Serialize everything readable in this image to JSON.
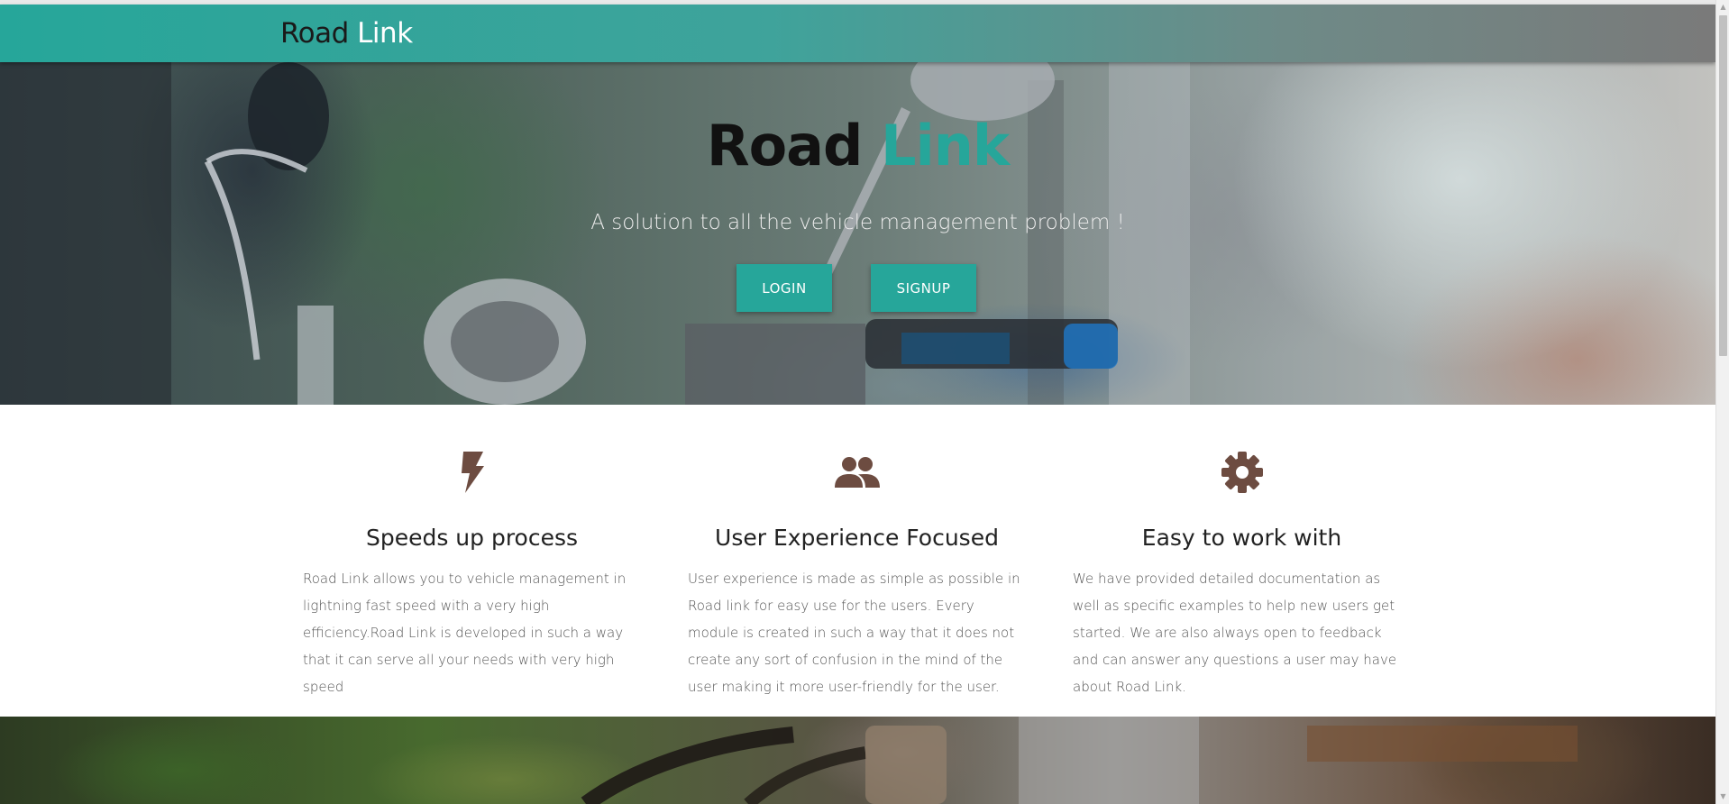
{
  "navbar": {
    "brand_part1": "Road",
    "brand_part2": "Link"
  },
  "hero": {
    "title_part1": "Road",
    "title_part2": "Link",
    "subtitle": "A solution to all the vehicle management problem !",
    "login_label": "LOGIN",
    "signup_label": "SIGNUP"
  },
  "features": [
    {
      "icon": "flash-icon",
      "title": "Speeds up process",
      "text": "Road Link allows you to vehicle management in lightning fast speed with a very high efficiency.Road Link is developed in such a way that it can serve all your needs with very high speed"
    },
    {
      "icon": "group-icon",
      "title": "User Experience Focused",
      "text": "User experience is made as simple as possible in Road link for easy use for the users. Every module is created in such a way that it does not create any sort of confusion in the mind of the user making it more user-friendly for the user."
    },
    {
      "icon": "settings-icon",
      "title": "Easy to work with",
      "text": "We have provided detailed documentation as well as specific examples to help new users get started. We are also always open to feedback and can answer any questions a user may have about Road Link."
    }
  ],
  "colors": {
    "accent": "#26a69a",
    "icon": "#6d4c41",
    "text": "#555555"
  }
}
